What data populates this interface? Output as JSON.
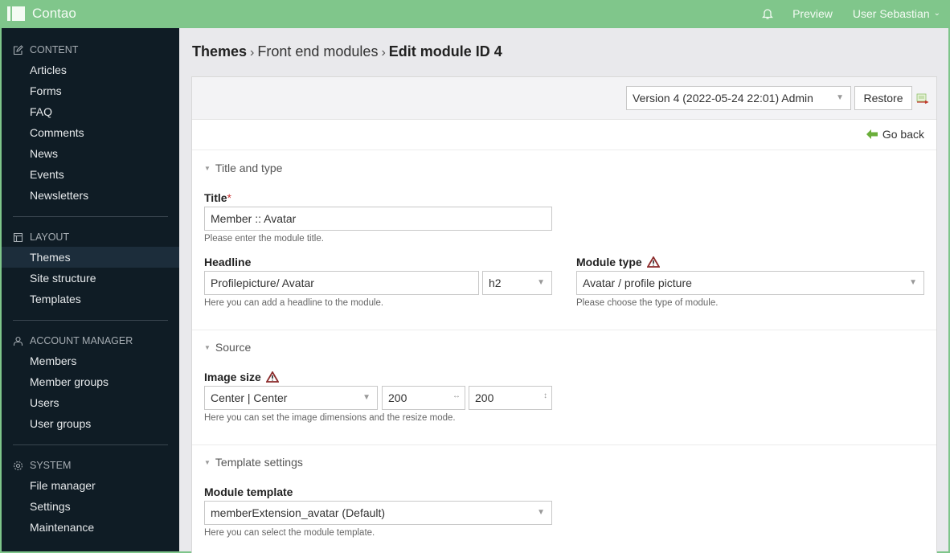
{
  "app": {
    "name": "Contao"
  },
  "topnav": {
    "preview": "Preview",
    "user": "User Sebastian"
  },
  "sidebar": {
    "groups": [
      {
        "title": "CONTENT",
        "icon": "edit-icon",
        "items": [
          "Articles",
          "Forms",
          "FAQ",
          "Comments",
          "News",
          "Events",
          "Newsletters"
        ]
      },
      {
        "title": "LAYOUT",
        "icon": "layout-icon",
        "items": [
          "Themes",
          "Site structure",
          "Templates"
        ],
        "active": "Themes"
      },
      {
        "title": "ACCOUNT MANAGER",
        "icon": "user-icon",
        "items": [
          "Members",
          "Member groups",
          "Users",
          "User groups"
        ]
      },
      {
        "title": "SYSTEM",
        "icon": "gear-icon",
        "items": [
          "File manager",
          "Settings",
          "Maintenance"
        ]
      }
    ]
  },
  "breadcrumb": {
    "items": [
      "Themes",
      "Front end modules",
      "Edit module ID 4"
    ],
    "separator": "›"
  },
  "version": {
    "selected": "Version 4 (2022-05-24 22:01) Admin",
    "restore_label": "Restore"
  },
  "goback_label": "Go back",
  "sections": {
    "title_type": {
      "legend": "Title and type",
      "title_label": "Title",
      "required_mark": "*",
      "title_value": "Member :: Avatar",
      "title_help": "Please enter the module title.",
      "headline_label": "Headline",
      "headline_value": "Profilepicture/ Avatar",
      "headline_level": "h2",
      "headline_help": "Here you can add a headline to the module.",
      "type_label": "Module type",
      "type_value": "Avatar / profile picture",
      "type_help": "Please choose the type of module."
    },
    "source": {
      "legend": "Source",
      "size_label": "Image size",
      "mode_value": "Center | Center",
      "width_value": "200",
      "height_value": "200",
      "size_help": "Here you can set the image dimensions and the resize mode."
    },
    "template": {
      "legend": "Template settings",
      "label": "Module template",
      "value": "memberExtension_avatar (Default)",
      "help": "Here you can select the module template."
    }
  },
  "colors": {
    "topbar": "#80c68b",
    "sidebar": "#0f1c25",
    "accent_green": "#6aae3a"
  }
}
